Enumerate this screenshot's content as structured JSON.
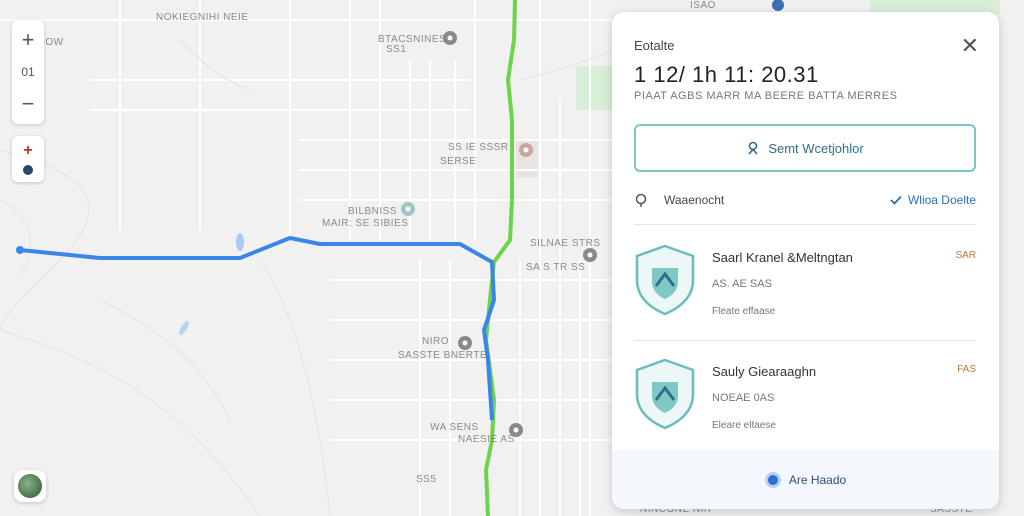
{
  "map": {
    "labels": [
      "NOKIEGNIHI NEIE",
      "BTACSNINES",
      "SS1",
      "ISAO",
      "SS IE SSSR",
      "SERSE",
      "SILNAE STRS",
      "SA S TR SS",
      "BILBNISS",
      "MAIR: SE SIBIES",
      "NIRO",
      "SASSTE BNERTE",
      "WA SENS",
      "NAESIE AS",
      "NINCGNE NIR",
      "SASSTE",
      "AISNOW",
      "SS5"
    ],
    "route_colors": {
      "primary": "#3a86e8",
      "alt": "#6ed34a"
    }
  },
  "controls": {
    "zoom_in": "+",
    "zoom_level": "01",
    "zoom_out": "−"
  },
  "panel": {
    "title": "Eotalte",
    "close": "✕",
    "time": "1 12/ 1h 11: 20.31",
    "subtitle": "PIAAT AGBS MARR MA BEERE BATTA MERRES",
    "send_button": "Semt Wcetjohlor",
    "row_label": "Waaenocht",
    "row_link": "Wlioa Doelte",
    "places": [
      {
        "name": "Saarl Kranel &Meltngtan",
        "badge": "SAR",
        "line2": "AS. AE SAS",
        "line3": "Fleate  effaase"
      },
      {
        "name": "Sauly Giearaaghn",
        "badge": "FAS",
        "line2": "NOEAE 0AS",
        "line3": "Eleare  eltaese"
      }
    ],
    "footer": "Are Haado"
  },
  "colors": {
    "accent": "#7cc6c4",
    "link": "#2c6fb5",
    "route_blue": "#3a86e8",
    "route_green": "#6ed34a"
  }
}
